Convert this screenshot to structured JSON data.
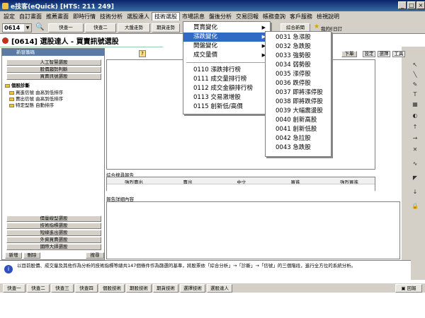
{
  "window": {
    "title": "e技客(eQuick)  [HTS: 211 249]"
  },
  "menubar": [
    "設定",
    "自訂畫面",
    "推薦畫面",
    "即時行情",
    "技術分析",
    "選股達人",
    "技術選股",
    "市場訊息",
    "盤後分析",
    "交易回報",
    "帳務查詢",
    "客戶服務",
    "檢視說明"
  ],
  "toolbar": {
    "stock_code": "0614",
    "buttons": [
      "快查一",
      "快查二",
      "大盤走勢",
      "期貨走勢"
    ],
    "right_buttons": [
      "綜合新聞"
    ],
    "my_bar": "我的E日訂"
  },
  "inner_window": {
    "title": "[0614] 選股達人 - 買賣訊號選股"
  },
  "left_panel": {
    "tab_top": "新發籌碼",
    "sections_top": [
      "人工智慧選股",
      "股價趨勢判斷",
      "買賣訊號選股"
    ],
    "tree_root": "個股診斷",
    "tree_items": [
      "買進信號 由高到低排序",
      "賣出信號 由高到低排序",
      "特定型態 自動排序"
    ],
    "sections_bottom": [
      "價量線型選股",
      "技術指標選股",
      "短線進出選股",
      "外資買賣選股",
      "國際大師選股"
    ],
    "actions": [
      "新增",
      "刪除",
      "搜尋"
    ]
  },
  "right_panel": {
    "top_button": "下單",
    "report_title": "綜合搜尋報告",
    "report_columns": [
      "強烈賣出",
      "賣出",
      "中立",
      "買進",
      "強烈買進"
    ],
    "detail_title": "報告詳細內容"
  },
  "menus": {
    "technical_pick": {
      "items": [
        "買賣變化",
        "漲跌變化",
        "開盤變化",
        "成交量價"
      ],
      "highlighted": "漲跌變化",
      "ranking": [
        "0110 漲跌排行榜",
        "0111 成交量排行榜",
        "0112 成交金額排行榜",
        "0113 交易激增股",
        "0115 創新低/高價"
      ]
    },
    "price_change": [
      "0031 急漲股",
      "0032 急跌股",
      "0033 強勢股",
      "0034 弱勢股",
      "0035 漲停股",
      "0036 跌停股",
      "0037 即將漲停股",
      "0038 即將跌停股",
      "0039 大幅震盪股",
      "0040 創新高股",
      "0041 創新低股",
      "0042 急拉股",
      "0043 急跌股"
    ]
  },
  "info_text": "以目前股價、成交量及其他作為分析的技術指標等總共147個條件作為篩選的基準，將股票依「綜合分析」→「診斷」→「信號」的三個階段，進行全方位的系統分析。",
  "side_tabs": [
    "設定",
    "選擇",
    "工具"
  ],
  "taskbar": [
    "快查一",
    "快查二",
    "快查三",
    "快查四",
    "個股技術",
    "期股技術",
    "期貨技術",
    "選擇技術",
    "選股達人"
  ],
  "taskbar_right": "回報"
}
